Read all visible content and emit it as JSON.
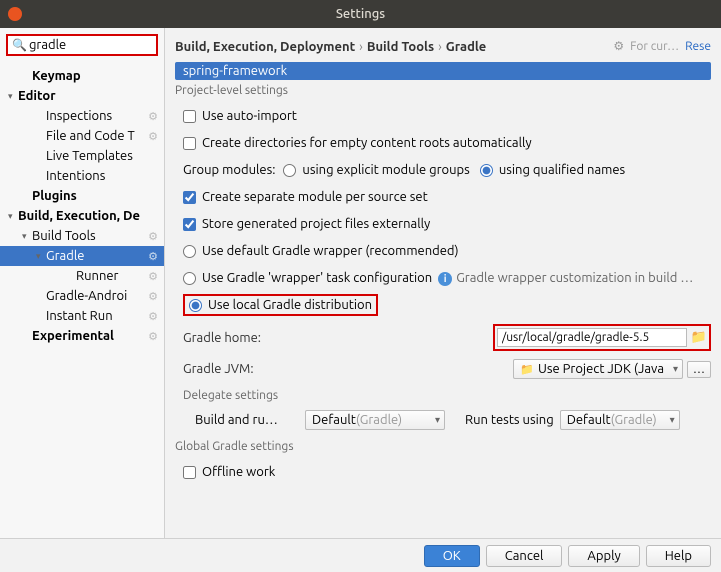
{
  "window": {
    "title": "Settings"
  },
  "search": {
    "value": "gradle"
  },
  "sidebar": {
    "items": [
      {
        "label": "Keymap",
        "bold": true,
        "indent": 1
      },
      {
        "label": "Editor",
        "bold": true,
        "indent": 0,
        "arrow": "▾"
      },
      {
        "label": "Inspections",
        "indent": 2,
        "gear": true
      },
      {
        "label": "File and Code T",
        "indent": 2,
        "gear": true
      },
      {
        "label": "Live Templates",
        "indent": 2
      },
      {
        "label": "Intentions",
        "indent": 2
      },
      {
        "label": "Plugins",
        "bold": true,
        "indent": 1
      },
      {
        "label": "Build, Execution, De",
        "bold": true,
        "indent": 0,
        "arrow": "▾"
      },
      {
        "label": "Build Tools",
        "indent": 1,
        "arrow": "▾",
        "gear": true
      },
      {
        "label": "Gradle",
        "indent": 2,
        "arrow": "▾",
        "gear": true,
        "selected": true
      },
      {
        "label": "Runner",
        "indent": 4,
        "gear": true
      },
      {
        "label": "Gradle-Androi",
        "indent": 2,
        "gear": true
      },
      {
        "label": "Instant Run",
        "indent": 2,
        "gear": true
      },
      {
        "label": "Experimental",
        "bold": true,
        "indent": 1,
        "gear": true
      }
    ]
  },
  "breadcrumb": {
    "a": "Build, Execution, Deployment",
    "b": "Build Tools",
    "c": "Gradle"
  },
  "header_links": {
    "for_current": "For cur…",
    "reset": "Rese"
  },
  "project_bar": "spring-framework",
  "section_project": "Project-level settings",
  "opts": {
    "auto_import": "Use auto-import",
    "create_dirs": "Create directories for empty content roots automatically",
    "group_modules": "Group modules:",
    "group_explicit": "using explicit module groups",
    "group_qualified": "using qualified names",
    "separate_module": "Create separate module per source set",
    "store_external": "Store generated project files externally",
    "wrapper_default": "Use default Gradle wrapper (recommended)",
    "wrapper_task": "Use Gradle 'wrapper' task configuration",
    "wrapper_hint": "Gradle wrapper customization in build …",
    "local_dist": "Use local Gradle distribution"
  },
  "fields": {
    "gradle_home_label": "Gradle home:",
    "gradle_home_value": "/usr/local/gradle/gradle-5.5",
    "gradle_jvm_label": "Gradle JVM:",
    "gradle_jvm_value": "Use Project JDK (Java"
  },
  "delegate": {
    "title": "Delegate settings",
    "build_run_label": "Build and ru…",
    "build_run_value": "Default (Gradle)",
    "tests_label": "Run tests using",
    "tests_value": "Default (Gradle)"
  },
  "global": {
    "title": "Global Gradle settings",
    "offline": "Offline work"
  },
  "footer": {
    "ok": "OK",
    "cancel": "Cancel",
    "apply": "Apply",
    "help": "Help"
  }
}
